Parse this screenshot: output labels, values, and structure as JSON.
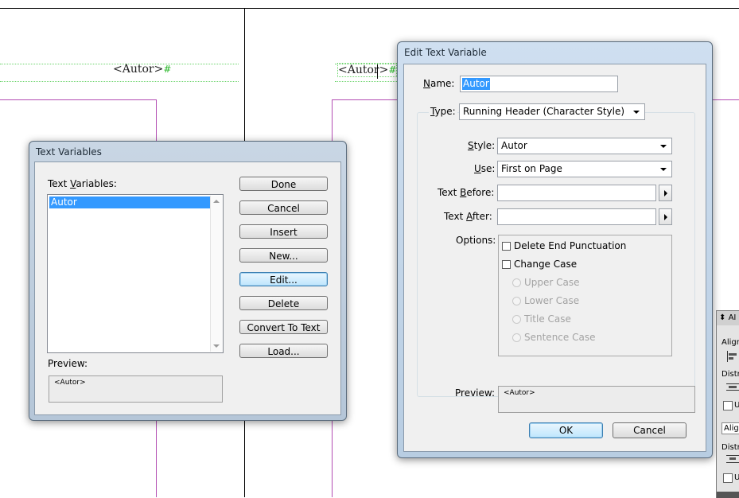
{
  "canvas": {
    "autor_left": "<Autor>",
    "autor_right": "<Autor>",
    "pilcrow": "#"
  },
  "text_variables_dialog": {
    "title": "Text Variables",
    "list_label": "Text Variables:",
    "list_label_accel": "V",
    "items": [
      "Autor"
    ],
    "selected_index": 0,
    "buttons": {
      "done": "Done",
      "cancel": "Cancel",
      "insert": "Insert",
      "new": "New...",
      "edit": "Edit...",
      "delete": "Delete",
      "convert": "Convert To Text",
      "load": "Load..."
    },
    "preview_label": "Preview:",
    "preview_value": "<Autor>"
  },
  "edit_text_variable_dialog": {
    "title": "Edit Text Variable",
    "name_label": "Name:",
    "name_value": "Autor",
    "type_label": "Type:",
    "type_value": "Running Header (Character Style)",
    "style_label": "Style:",
    "style_value": "Autor",
    "use_label": "Use:",
    "use_value": "First on Page",
    "text_before_label": "Text Before:",
    "text_before_value": "",
    "text_after_label": "Text After:",
    "text_after_value": "",
    "options_label": "Options:",
    "checkboxes": [
      {
        "label": "Delete End Punctuation",
        "checked": false
      },
      {
        "label": "Change Case",
        "checked": false
      }
    ],
    "radios": [
      {
        "label": "Upper Case",
        "enabled": false
      },
      {
        "label": "Lower Case",
        "enabled": false
      },
      {
        "label": "Title Case",
        "enabled": false
      },
      {
        "label": "Sentence Case",
        "enabled": false
      }
    ],
    "preview_label": "Preview:",
    "preview_value": "<Autor>",
    "ok": "OK",
    "cancel": "Cancel"
  },
  "side_panel": {
    "title": "AI",
    "align_label": "Align",
    "distri_label": "Distri",
    "align2_label": "Align",
    "distri2_label": "Distri",
    "u_label": "U"
  }
}
